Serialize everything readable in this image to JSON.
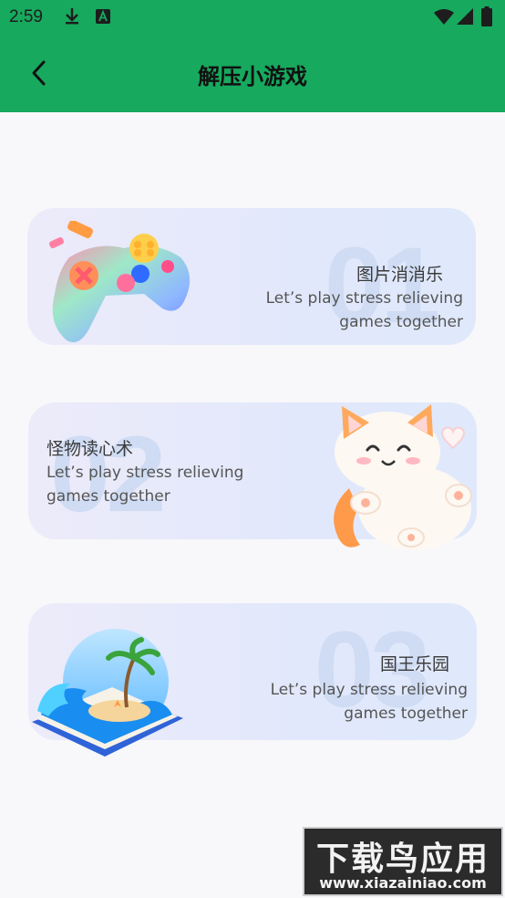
{
  "status_bar": {
    "time": "2:59"
  },
  "app_bar": {
    "title": "解压小游戏"
  },
  "games": [
    {
      "number": "01",
      "name": "图片消消乐",
      "description_line1": "Let’s play stress relieving",
      "description_line2": "games together",
      "art": "gamepad-icon"
    },
    {
      "number": "02",
      "name": "怪物读心术",
      "description_line1": "Let’s play stress relieving",
      "description_line2": "games together",
      "art": "cat-icon"
    },
    {
      "number": "03",
      "name": "国王乐园",
      "description_line1": "Let’s play stress relieving",
      "description_line2": "games together",
      "art": "island-book-icon"
    }
  ],
  "watermark": {
    "title": "下载鸟应用",
    "url": "www.xiazainiao.com"
  },
  "colors": {
    "accent": "#17a95e",
    "card": "#e4e9fb",
    "number": "#cfdcf3"
  }
}
